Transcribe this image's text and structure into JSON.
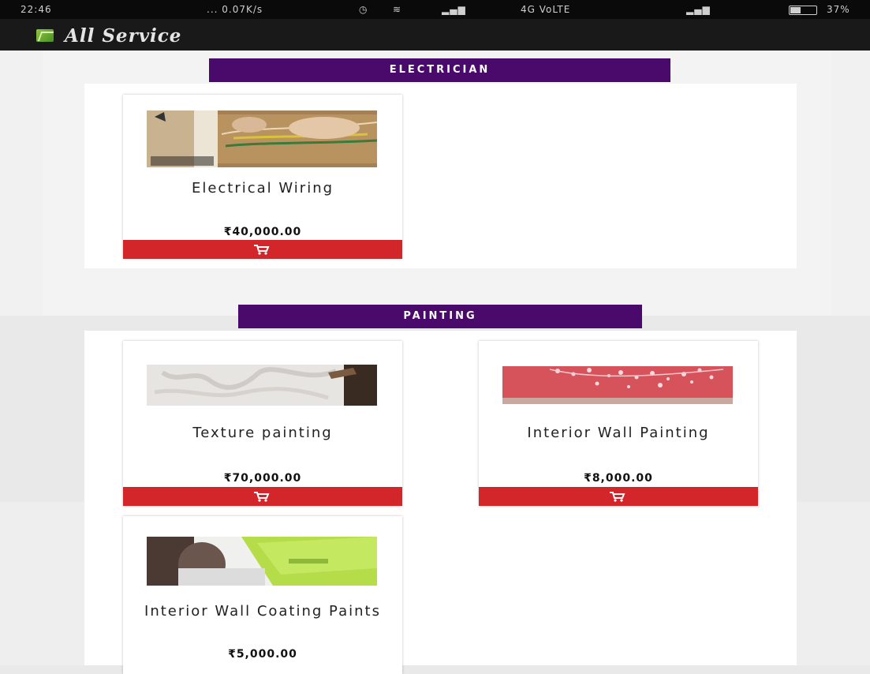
{
  "status_bar": {
    "time": "22:46",
    "network_speed": "... 0.07K/s",
    "carrier": "4G VoLTE",
    "battery": "37%"
  },
  "app_bar": {
    "logo": "app-logo-icon",
    "title": "All Service"
  },
  "sections": [
    {
      "title": "ELECTRICIAN",
      "products": [
        {
          "name": "Electrical Wiring",
          "price": "₹40,000.00",
          "image": "electrical-wiring-image",
          "button_icon": "cart-icon"
        }
      ]
    },
    {
      "title": "PAINTING",
      "products": [
        {
          "name": "Texture painting",
          "price": "₹70,000.00",
          "image": "texture-painting-image",
          "button_icon": "cart-icon"
        },
        {
          "name": "Interior Wall Painting",
          "price": "₹8,000.00",
          "image": "interior-wall-painting-image",
          "button_icon": "cart-icon"
        },
        {
          "name": "Interior Wall Coating Paints",
          "price": "₹5,000.00",
          "image": "wall-coating-image",
          "button_icon": "cart-icon"
        }
      ]
    }
  ],
  "colors": {
    "section_header": "#4a0a6b",
    "cart_button": "#d3262a",
    "app_bar": "#191919"
  }
}
